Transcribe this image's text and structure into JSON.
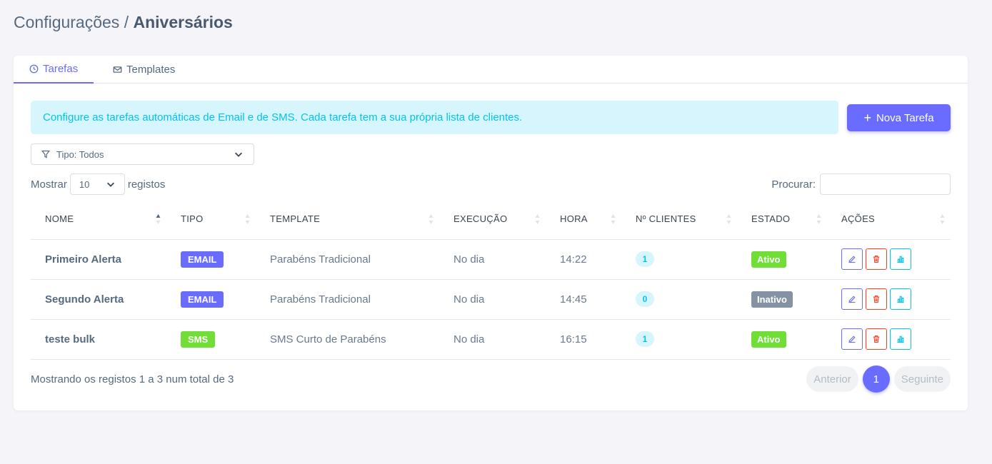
{
  "header": {
    "breadcrumb_parent": "Configurações /",
    "breadcrumb_current": "Aniversários"
  },
  "tabs": [
    {
      "label": "Tarefas",
      "icon": "clock-icon",
      "active": true
    },
    {
      "label": "Templates",
      "icon": "envelope-icon",
      "active": false
    }
  ],
  "alert": {
    "text": "Configure as tarefas automáticas de Email e de SMS. Cada tarefa tem a sua própria lista de clientes."
  },
  "actions": {
    "new_task_label": "Nova Tarefa"
  },
  "filter": {
    "type_label": "Tipo: Todos"
  },
  "length": {
    "prefix": "Mostrar",
    "value": "10",
    "suffix": "registos"
  },
  "search": {
    "label": "Procurar:",
    "value": ""
  },
  "table": {
    "columns": [
      "NOME",
      "TIPO",
      "TEMPLATE",
      "EXECUÇÃO",
      "HORA",
      "Nº CLIENTES",
      "ESTADO",
      "AÇÕES"
    ],
    "rows": [
      {
        "name": "Primeiro Alerta",
        "type": "EMAIL",
        "template": "Parabéns Tradicional",
        "execution": "No dia",
        "time": "14:22",
        "clients": "1",
        "state": "Ativo"
      },
      {
        "name": "Segundo Alerta",
        "type": "EMAIL",
        "template": "Parabéns Tradicional",
        "execution": "No dia",
        "time": "14:45",
        "clients": "0",
        "state": "Inativo"
      },
      {
        "name": "teste bulk",
        "type": "SMS",
        "template": "SMS Curto de Parabéns",
        "execution": "No dia",
        "time": "16:15",
        "clients": "1",
        "state": "Ativo"
      }
    ]
  },
  "footer": {
    "info": "Mostrando os registos 1 a 3 num total de 3",
    "prev_label": "Anterior",
    "page": "1",
    "next_label": "Seguinte"
  },
  "colors": {
    "primary": "#696cff",
    "email_badge": "#696cff",
    "sms_badge": "#71dd37",
    "active_state": "#71dd37",
    "inactive_state": "#8592a3",
    "info": "#03c3ec",
    "danger": "#ff3e1d"
  }
}
